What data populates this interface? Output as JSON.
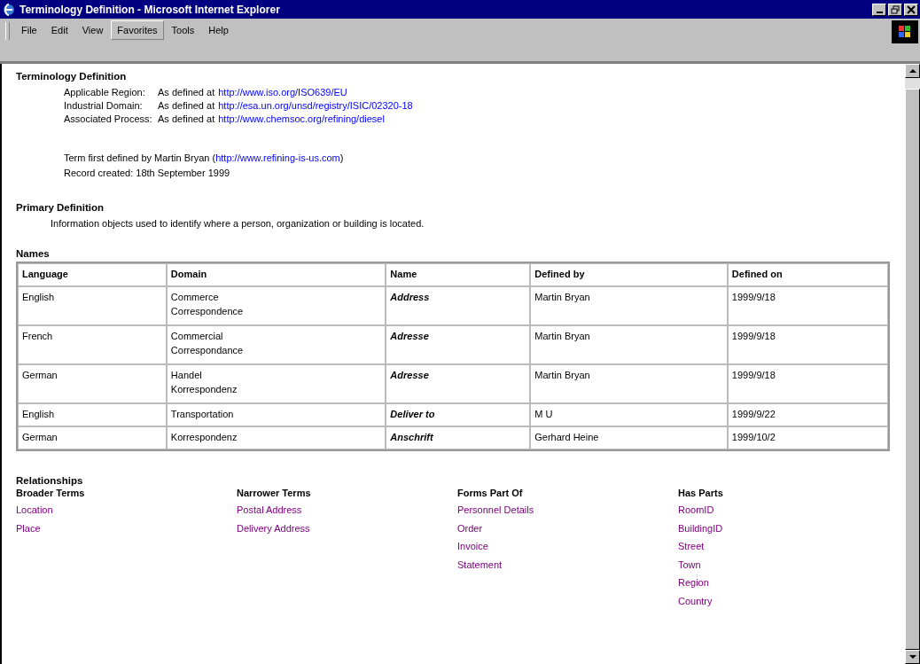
{
  "window": {
    "title": "Terminology Definition - Microsoft Internet Explorer"
  },
  "menu": [
    {
      "label": "File",
      "selected": false
    },
    {
      "label": "Edit",
      "selected": false
    },
    {
      "label": "View",
      "selected": false
    },
    {
      "label": "Favorites",
      "selected": true
    },
    {
      "label": "Tools",
      "selected": false
    },
    {
      "label": "Help",
      "selected": false
    }
  ],
  "heading": "Terminology Definition",
  "definitions": [
    {
      "label": "Applicable Region:",
      "text": "As defined at",
      "link": "http://www.iso.org/ISO639/EU"
    },
    {
      "label": "Industrial Domain:",
      "text": "As defined at",
      "link": "http://esa.un.org/unsd/registry/ISIC/02320-18"
    },
    {
      "label": "Associated Process:",
      "text": "As defined at",
      "link": "http://www.chemsoc.org/refining/diesel"
    }
  ],
  "author": {
    "text": "Term first defined by Martin Bryan (",
    "link": "http://www.refining-is-us.com",
    "after": ")"
  },
  "record_created": "Record created: 18th September 1999",
  "primary_definition": {
    "heading": "Primary Definition",
    "text": "Information objects used to identify where a person, organization or building is located."
  },
  "names": {
    "heading": "Names",
    "columns": [
      "Language",
      "Domain",
      "Name",
      "Defined by",
      "Defined on"
    ],
    "rows": [
      [
        "English",
        "Commerce\nCorrespondence",
        "Address",
        "Martin Bryan",
        "1999/9/18"
      ],
      [
        "French",
        "Commercial\nCorrespondance",
        "Adresse",
        "Martin Bryan",
        "1999/9/18"
      ],
      [
        "German",
        "Handel\nKorrespondenz",
        "Adresse",
        "Martin Bryan",
        "1999/9/18"
      ],
      [
        "English",
        "Transportation",
        "Deliver to",
        "M U",
        "1999/9/22"
      ],
      [
        "German",
        "Korrespondenz",
        "Anschrift",
        "Gerhard Heine",
        "1999/10/2"
      ]
    ]
  },
  "relationships": {
    "heading": "Relationships",
    "groups": [
      {
        "heading": "Broader Terms",
        "links": [
          "Location",
          "Place"
        ]
      },
      {
        "heading": "Narrower Terms",
        "links": [
          "Postal Address",
          "Delivery Address"
        ]
      },
      {
        "heading": "Forms Part Of",
        "links": [
          "Personnel Details",
          "Order",
          "Invoice",
          "Statement"
        ]
      },
      {
        "heading": "Has Parts",
        "links": [
          "RoomID",
          "BuildingID",
          "Street",
          "Town",
          "Region",
          "Country"
        ]
      }
    ]
  }
}
